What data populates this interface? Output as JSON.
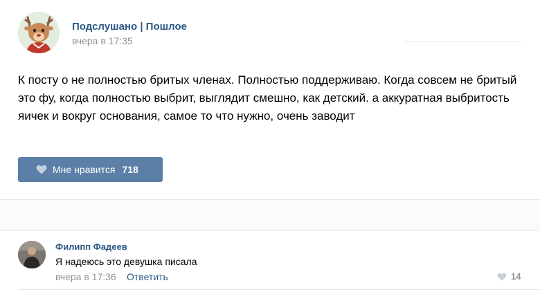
{
  "post": {
    "author": "Подслушано | Пошлое",
    "time": "вчера в 17:35",
    "text": "К посту о не полностью бритых членах. Полностью поддерживаю. Когда совсем не бритый это фу, когда полностью выбрит, выглядит смешно, как детский. а аккуратная выбритость яичек и вокруг основания, самое то что нужно, очень заводит",
    "like_label": "Мне нравится",
    "like_count": "718",
    "like_icon": "heart-icon"
  },
  "comment": {
    "author": "Филипп Фадеев",
    "text": "Я надеюсь это девушка писала",
    "time": "вчера в 17:36",
    "reply_label": "Ответить",
    "like_count": "14",
    "like_icon": "heart-icon"
  },
  "colors": {
    "link": "#2a5885",
    "like_button": "#5b7fa6",
    "meta": "#939393",
    "divider": "#e7e8ec"
  }
}
